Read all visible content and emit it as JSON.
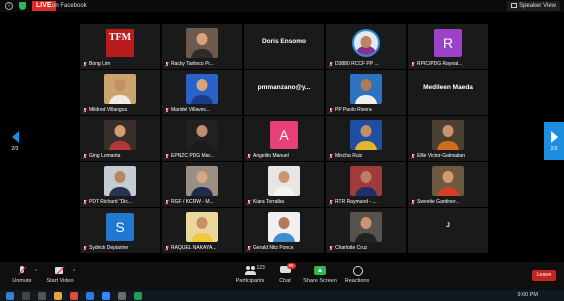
{
  "top_bar": {
    "live_badge": "LIVE",
    "live_target": "on Facebook",
    "view_button": "Speaker View"
  },
  "pagination": {
    "left": "2/3",
    "right": "2/3"
  },
  "participants": [
    {
      "name": "Bong Lim",
      "avatar": "logo",
      "logo_text": "TFM",
      "color": "#b81c1c"
    },
    {
      "name": "Racky Taritoco Pi...",
      "avatar": "photo",
      "bg": "#6d5a4c",
      "skin": "#d7a17c",
      "shirt": "#2c2c2c"
    },
    {
      "name": "Doris Ensomo",
      "avatar": "text"
    },
    {
      "name": "D3880 RCCF PP ...",
      "avatar": "photo-round",
      "bg": "#e4e9f2",
      "skin": "#b98562",
      "shirt": "#8a2f8f"
    },
    {
      "name": "RPIC/PDG Raynal...",
      "avatar": "letter",
      "letter": "R",
      "color": "#9b42c8"
    },
    {
      "name": "Mildred Villangca",
      "avatar": "photo",
      "bg": "#c9a46d",
      "skin": "#c48d64",
      "shirt": "#f1ece3"
    },
    {
      "name": "Maridel Villaves...",
      "avatar": "photo",
      "bg": "#2a63c7",
      "skin": "#d8a57e",
      "shirt": "#1d3c88"
    },
    {
      "name": "pmmanzano@y...",
      "avatar": "text"
    },
    {
      "name": "PP Paolo Rivera",
      "avatar": "photo",
      "bg": "#2d73bf",
      "skin": "#b27a55",
      "shirt": "#f1f1f1"
    },
    {
      "name": "Medileen Maeda",
      "avatar": "text"
    },
    {
      "name": "Ging Lomanta",
      "avatar": "photo",
      "bg": "#3a2e2a",
      "skin": "#d49c72",
      "shirt": "#b53838"
    },
    {
      "name": "EPNZC PDG Mar...",
      "avatar": "photo",
      "bg": "#24201f",
      "skin": "#bf8c6d",
      "shirt": "#1b1b1b"
    },
    {
      "name": "Angelito Manuel",
      "avatar": "letter",
      "letter": "A",
      "color": "#e8417a"
    },
    {
      "name": "Mischa Ruiz",
      "avatar": "photo",
      "bg": "#1f4fa0",
      "skin": "#c48d66",
      "shirt": "#e4b42a"
    },
    {
      "name": "Ellie Victor-Galmaitan",
      "avatar": "photo",
      "bg": "#4a4030",
      "skin": "#c9936c",
      "shirt": "#d06a1e"
    },
    {
      "name": "PDT Richard \"Dic...",
      "avatar": "photo",
      "bg": "#c4cbd2",
      "skin": "#b88662",
      "shirt": "#243452"
    },
    {
      "name": "RGF / KCRW - M...",
      "avatar": "photo",
      "bg": "#9b8f84",
      "skin": "#d7a684",
      "shirt": "#1f2b4c"
    },
    {
      "name": "Kiara Torralba",
      "avatar": "photo",
      "bg": "#e8e6e4",
      "skin": "#c99572",
      "shirt": "#f3f3f3"
    },
    {
      "name": "RTR Raymund - ...",
      "avatar": "photo",
      "bg": "#a13a3a",
      "skin": "#b88262",
      "shirt": "#1e2f6a"
    },
    {
      "name": "Sweetie Gardiner...",
      "avatar": "photo",
      "bg": "#6b5a3f",
      "skin": "#d39a70",
      "shirt": "#d43f2c"
    },
    {
      "name": "Sydrick Depiarine",
      "avatar": "letter",
      "letter": "S",
      "color": "#2178d1"
    },
    {
      "name": "RAQUEL NAKAYA...",
      "avatar": "photo",
      "bg": "#e9d79b",
      "skin": "#c78e67",
      "shirt": "#f0c93a"
    },
    {
      "name": "Gerald Nitz Ponce",
      "avatar": "photo",
      "bg": "#f0f0f0",
      "skin": "#b37c58",
      "shirt": "#3a8fd0"
    },
    {
      "name": "Charlotte Cruz",
      "avatar": "photo",
      "bg": "#56524e",
      "skin": "#cc9470",
      "shirt": "#222222"
    },
    {
      "name": "J",
      "avatar": "text"
    }
  ],
  "toolbar": {
    "unmute": "Unmute",
    "start_video": "Start Video",
    "participants": "Participants",
    "participants_count": "123",
    "chat": "Chat",
    "chat_badge": "99",
    "share_screen": "Share Screen",
    "reactions": "Reactions",
    "leave": "Leave"
  },
  "taskbar": {
    "time": "9:00 PM"
  }
}
